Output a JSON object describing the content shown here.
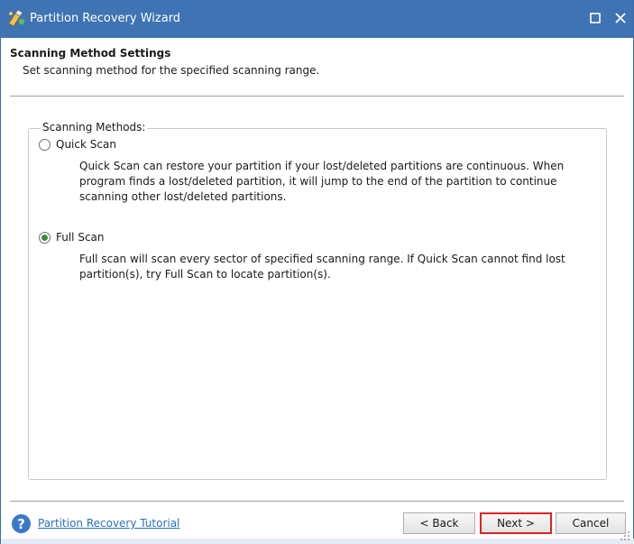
{
  "window": {
    "title": "Partition Recovery Wizard"
  },
  "header": {
    "title": "Scanning Method Settings",
    "subtitle": "Set scanning method for the specified scanning range."
  },
  "scan_methods": {
    "legend": "Scanning Methods:",
    "options": [
      {
        "label": "Quick Scan",
        "checked": false,
        "description": "Quick Scan can restore your partition if your lost/deleted partitions are continuous. When program finds a lost/deleted partition, it will jump to the end of the partition to continue scanning other lost/deleted partitions."
      },
      {
        "label": "Full Scan",
        "checked": true,
        "description": "Full scan will scan every sector of specified scanning range. If Quick Scan cannot find lost partition(s), try Full Scan to locate partition(s)."
      }
    ]
  },
  "footer": {
    "help_glyph": "?",
    "tutorial_link": "Partition Recovery Tutorial",
    "back_label": "< Back",
    "next_label": "Next >",
    "cancel_label": "Cancel"
  },
  "colors": {
    "titlebar": "#3f73b4",
    "link": "#2a6fc2",
    "highlight_border": "#e02222",
    "radio_checked": "#3b8e3b"
  },
  "icons": {
    "app": "partition-wand-icon",
    "maximize": "maximize-icon",
    "close": "close-icon",
    "help": "help-icon"
  }
}
